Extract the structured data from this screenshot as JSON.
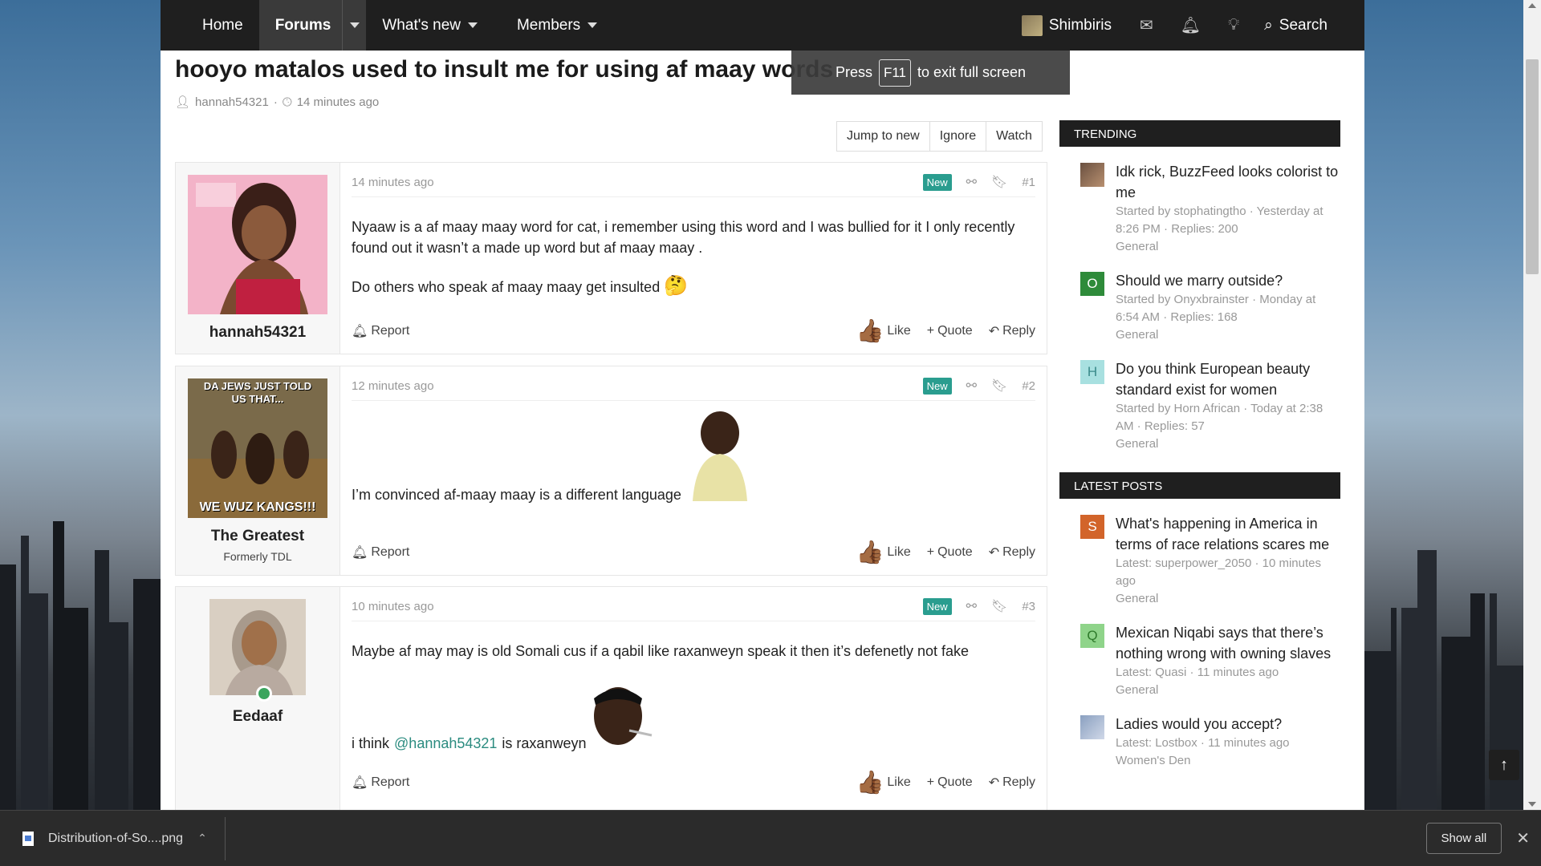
{
  "nav": {
    "home": "Home",
    "forums": "Forums",
    "whats_new": "What's new",
    "members": "Members",
    "username": "Shimbiris",
    "search": "Search"
  },
  "fullscreen": {
    "press": "Press",
    "key": "F11",
    "text": "to exit full screen"
  },
  "thread": {
    "title": "hooyo matalos used to insult me for using af maay words",
    "author": "hannah54321",
    "time": "14 minutes ago",
    "actions": {
      "jump": "Jump to new",
      "ignore": "Ignore",
      "watch": "Watch"
    }
  },
  "posts": [
    {
      "username": "hannah54321",
      "user_title": "",
      "time": "14 minutes ago",
      "badge": "New",
      "num": "#1",
      "body_line1": "Nyaaw is a af maay maay word for cat, i remember using this word and I was bullied for it I only recently found out it wasn’t a made up word but af maay maay .",
      "body_line2": "Do others who speak af maay maay get insulted"
    },
    {
      "username": "The Greatest",
      "user_title": "Formerly TDL",
      "avatar_top": "DA JEWS JUST TOLD US THAT...",
      "avatar_bottom": "WE WUZ KANGS!!!",
      "time": "12 minutes ago",
      "badge": "New",
      "num": "#2",
      "body_line1": "I’m convinced af-maay maay is a different language"
    },
    {
      "username": "Eedaaf",
      "user_title": "",
      "time": "10 minutes ago",
      "badge": "New",
      "num": "#3",
      "body_line1": "Maybe af may may is old Somali cus if a qabil like raxanweyn speak it then it’s defenetly not fake",
      "body_pre": "i think",
      "mention": "@hannah54321",
      "body_post": "is raxanweyn"
    }
  ],
  "post_actions": {
    "report": "Report",
    "like": "Like",
    "quote": "Quote",
    "reply": "Reply"
  },
  "trending": {
    "heading": "TRENDING",
    "items": [
      {
        "title": "Idk rick, BuzzFeed looks colorist to me",
        "meta": "Started by stophatingtho · Yesterday at 8:26 PM · Replies: 200",
        "forum": "General"
      },
      {
        "letter": "O",
        "title": "Should we marry outside?",
        "meta": "Started by Onyxbrainster · Monday at 6:54 AM · Replies: 168",
        "forum": "General"
      },
      {
        "letter": "H",
        "title": "Do you think European beauty standard exist for women",
        "meta": "Started by Horn African · Today at 2:38 AM · Replies: 57",
        "forum": "General"
      }
    ]
  },
  "latest": {
    "heading": "LATEST POSTS",
    "items": [
      {
        "letter": "S",
        "title": "What's happening in America in terms of race relations scares me",
        "meta": "Latest: superpower_2050 · 10 minutes ago",
        "forum": "General"
      },
      {
        "letter": "Q",
        "title": "Mexican Niqabi says that there’s nothing wrong with owning slaves",
        "meta": "Latest: Quasi · 11 minutes ago",
        "forum": "General"
      },
      {
        "title": "Ladies would you accept?",
        "meta": "Latest: Lostbox · 11 minutes ago",
        "forum": "Women's Den"
      }
    ]
  },
  "download": {
    "filename": "Distribution-of-So....png",
    "show_all": "Show all"
  },
  "colors": {
    "nav_bg": "#1f1f1f",
    "accent_new": "#2a9d8f",
    "mention": "#2a8b7f"
  }
}
